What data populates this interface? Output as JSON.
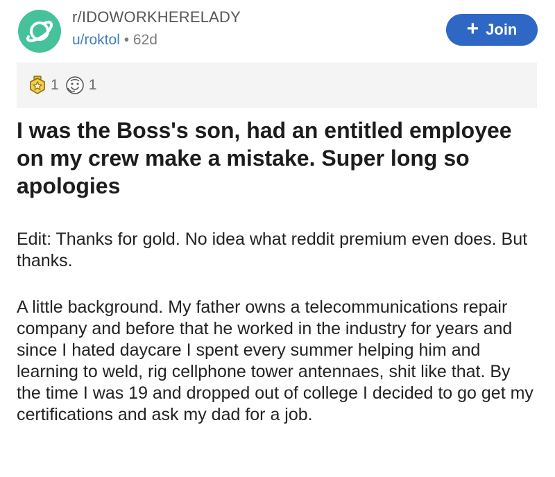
{
  "header": {
    "subreddit": "r/IDOWORKHERELADY",
    "author": "u/roktol",
    "separator": "•",
    "age": "62d",
    "join_label": "Join",
    "join_icon": "plus-icon"
  },
  "awards": [
    {
      "icon": "gold-award-icon",
      "count": "1"
    },
    {
      "icon": "wholesome-award-icon",
      "count": "1"
    }
  ],
  "post": {
    "title": "I was the Boss's son, had an entitled employee on my crew make a mistake. Super long so apologies",
    "paragraphs": [
      "Edit: Thanks for gold. No idea what reddit premium even does. But thanks.",
      "A little background. My father owns a telecommunications repair company and before that he worked in the industry for years and since I hated daycare I spent every summer helping him and learning to weld, rig cellphone tower antennaes, shit like that. By the time I was 19 and dropped out of college I decided to go get my certifications and ask my dad for a job."
    ]
  },
  "colors": {
    "avatar_bg": "#45c29a",
    "join_bg": "#2f67c4",
    "author_link": "#3f7fbf",
    "awards_bar_bg": "#f4f4f4"
  }
}
